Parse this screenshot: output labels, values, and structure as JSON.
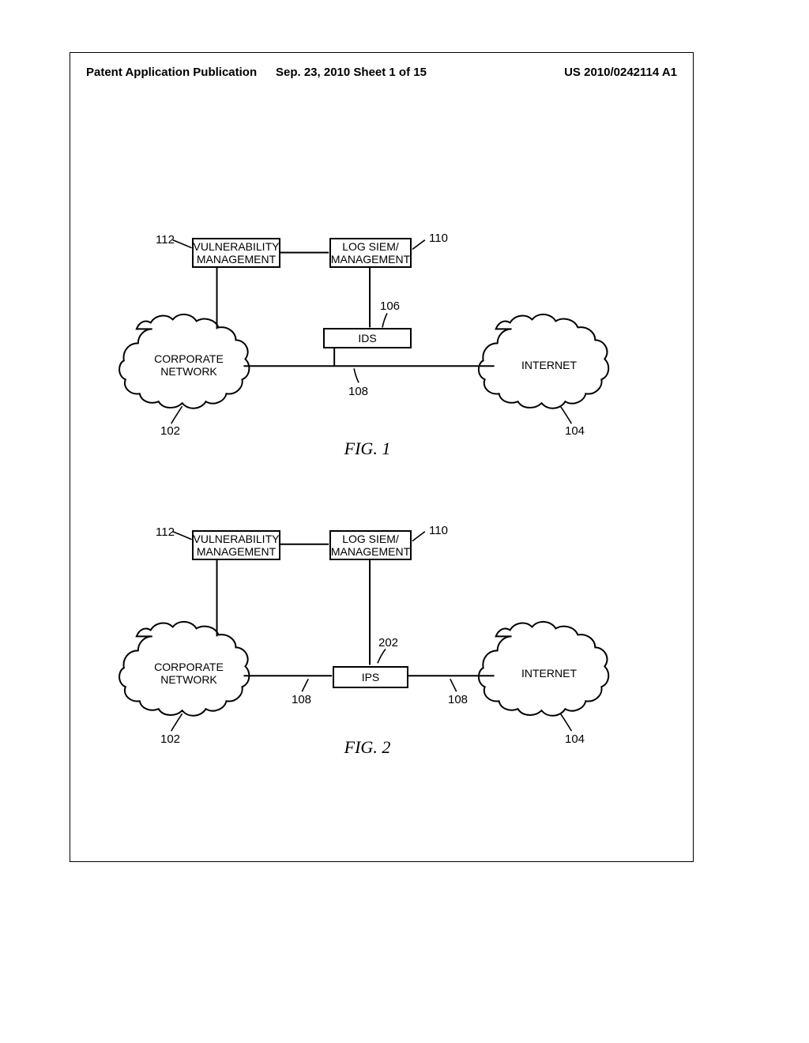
{
  "header": {
    "left": "Patent Application Publication",
    "mid": "Sep. 23, 2010  Sheet 1 of 15",
    "right": "US 2010/0242114 A1"
  },
  "fig1": {
    "caption": "FIG. 1",
    "vuln_box_l1": "VULNERABILITY",
    "vuln_box_l2": "MANAGEMENT",
    "siem_box_l1": "LOG SIEM/",
    "siem_box_l2": "MANAGEMENT",
    "ids_box": "IDS",
    "corp_l1": "CORPORATE",
    "corp_l2": "NETWORK",
    "internet": "INTERNET",
    "ref_112": "112",
    "ref_110": "110",
    "ref_106": "106",
    "ref_108": "108",
    "ref_102": "102",
    "ref_104": "104"
  },
  "fig2": {
    "caption": "FIG. 2",
    "vuln_box_l1": "VULNERABILITY",
    "vuln_box_l2": "MANAGEMENT",
    "siem_box_l1": "LOG SIEM/",
    "siem_box_l2": "MANAGEMENT",
    "ips_box": "IPS",
    "corp_l1": "CORPORATE",
    "corp_l2": "NETWORK",
    "internet": "INTERNET",
    "ref_112": "112",
    "ref_110": "110",
    "ref_202": "202",
    "ref_108a": "108",
    "ref_108b": "108",
    "ref_102": "102",
    "ref_104": "104"
  }
}
